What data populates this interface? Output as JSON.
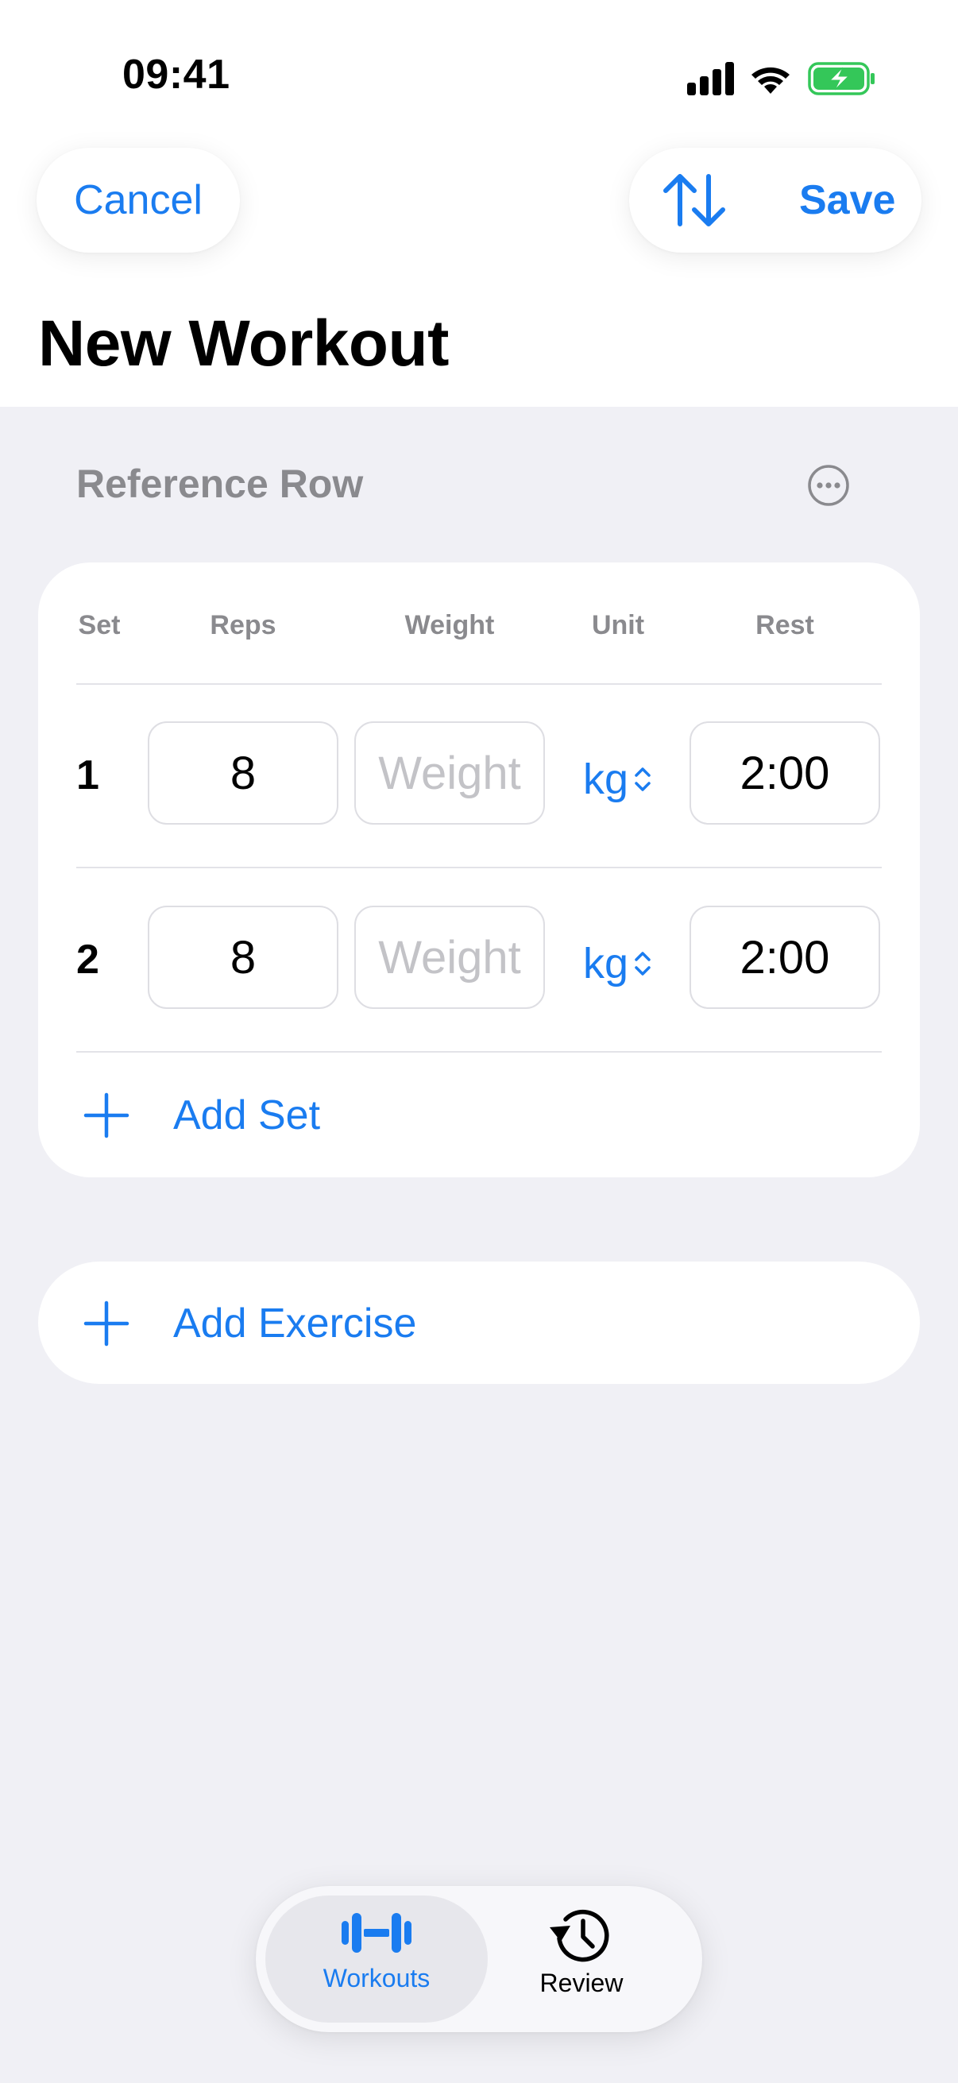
{
  "status_bar": {
    "time": "09:41"
  },
  "toolbar": {
    "cancel_label": "Cancel",
    "save_label": "Save"
  },
  "page_title": "New Workout",
  "exercise": {
    "name": "Reference Row",
    "columns": [
      "Set",
      "Reps",
      "Weight",
      "Unit",
      "Rest"
    ],
    "sets": [
      {
        "set": "1",
        "reps": "8",
        "weight_placeholder": "Weight",
        "unit": "kg",
        "rest": "2:00"
      },
      {
        "set": "2",
        "reps": "8",
        "weight_placeholder": "Weight",
        "unit": "kg",
        "rest": "2:00"
      }
    ],
    "add_set_label": "Add Set"
  },
  "add_exercise_label": "Add Exercise",
  "tabs": [
    {
      "label": "Workouts",
      "icon": "dumbbell-icon",
      "active": true
    },
    {
      "label": "Review",
      "icon": "history-icon",
      "active": false
    }
  ],
  "colors": {
    "accent": "#1a7cf0",
    "background": "#f0f0f5",
    "battery": "#34c759"
  }
}
